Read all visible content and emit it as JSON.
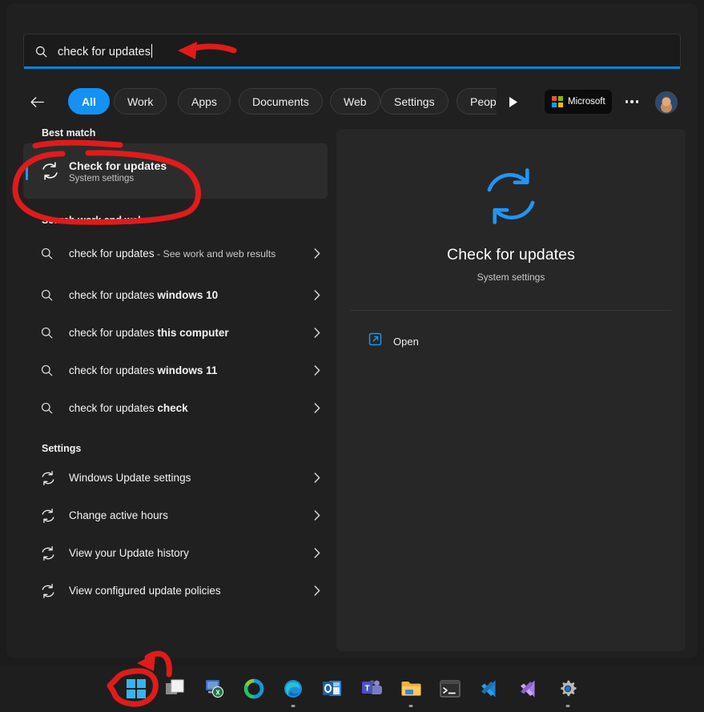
{
  "search": {
    "value": "check for updates",
    "icon": "search-icon"
  },
  "tabbar": {
    "back_icon": "back-arrow-icon",
    "scroll_right_icon": "play-triangle-icon",
    "tabs": [
      {
        "label": "All",
        "active": true
      },
      {
        "label": "Work",
        "active": false
      },
      {
        "label": "Apps",
        "active": false
      },
      {
        "label": "Documents",
        "active": false
      },
      {
        "label": "Web",
        "active": false
      },
      {
        "label": "Settings",
        "active": false
      },
      {
        "label": "People",
        "active": false
      }
    ],
    "microsoft_badge": "Microsoft",
    "more_icon": "ellipsis-icon",
    "avatar_icon": "user-avatar"
  },
  "results": {
    "best_match_heading": "Best match",
    "best_match": {
      "title": "Check for updates",
      "subtitle": "System settings",
      "icon": "refresh-icon"
    },
    "web_heading": "Search work and web",
    "web_items": [
      {
        "query": "check for updates",
        "suffix": " - See work and web results",
        "suffix_style": "dim",
        "icon": "search-icon",
        "chevron": "chevron-right-icon"
      },
      {
        "query": "check for updates ",
        "suffix": "windows 10",
        "suffix_style": "bold",
        "icon": "search-icon",
        "chevron": "chevron-right-icon"
      },
      {
        "query": "check for updates ",
        "suffix": "this computer",
        "suffix_style": "bold",
        "icon": "search-icon",
        "chevron": "chevron-right-icon"
      },
      {
        "query": "check for updates ",
        "suffix": "windows 11",
        "suffix_style": "bold",
        "icon": "search-icon",
        "chevron": "chevron-right-icon"
      },
      {
        "query": "check for updates ",
        "suffix": "check",
        "suffix_style": "bold",
        "icon": "search-icon",
        "chevron": "chevron-right-icon"
      }
    ],
    "settings_heading": "Settings",
    "settings_items": [
      {
        "label": "Windows Update settings",
        "icon": "refresh-icon",
        "chevron": "chevron-right-icon"
      },
      {
        "label": "Change active hours",
        "icon": "refresh-icon",
        "chevron": "chevron-right-icon"
      },
      {
        "label": "View your Update history",
        "icon": "refresh-icon",
        "chevron": "chevron-right-icon"
      },
      {
        "label": "View configured update policies",
        "icon": "refresh-icon",
        "chevron": "chevron-right-icon"
      }
    ]
  },
  "preview": {
    "icon": "refresh-icon-large",
    "title": "Check for updates",
    "subtitle": "System settings",
    "open_label": "Open",
    "open_icon": "external-link-icon"
  },
  "taskbar": {
    "items": [
      {
        "name": "start-button",
        "icon": "windows-logo-icon",
        "running": false
      },
      {
        "name": "task-view-button",
        "icon": "task-view-icon",
        "running": false
      },
      {
        "name": "excel-shortcut",
        "icon": "excel-icon",
        "running": false
      },
      {
        "name": "ring-app",
        "icon": "ring-icon",
        "running": false
      },
      {
        "name": "edge-button",
        "icon": "edge-icon",
        "running": true
      },
      {
        "name": "outlook-button",
        "icon": "outlook-icon",
        "running": false
      },
      {
        "name": "teams-button",
        "icon": "teams-icon",
        "running": false
      },
      {
        "name": "file-explorer-button",
        "icon": "folder-icon",
        "running": true
      },
      {
        "name": "terminal-button",
        "icon": "terminal-icon",
        "running": false
      },
      {
        "name": "vscode-button",
        "icon": "vscode-icon",
        "running": false
      },
      {
        "name": "visual-studio-button",
        "icon": "visual-studio-icon",
        "running": false
      },
      {
        "name": "settings-button",
        "icon": "gear-icon",
        "running": true
      }
    ]
  },
  "annotations": {
    "color": "#e01b1b",
    "items": [
      {
        "name": "arrow-to-search-box",
        "shape": "arrow-left"
      },
      {
        "name": "circle-around-best-match",
        "shape": "ellipse"
      },
      {
        "name": "arrow-to-start-button",
        "shape": "arrow-curved"
      },
      {
        "name": "circle-around-start-button",
        "shape": "polygon"
      }
    ]
  },
  "colors": {
    "accent": "#1391f5",
    "panel_bg": "#202020",
    "preview_bg": "#272727",
    "highlight_bg": "#2c2c2c",
    "annotation_red": "#e01b1b"
  }
}
